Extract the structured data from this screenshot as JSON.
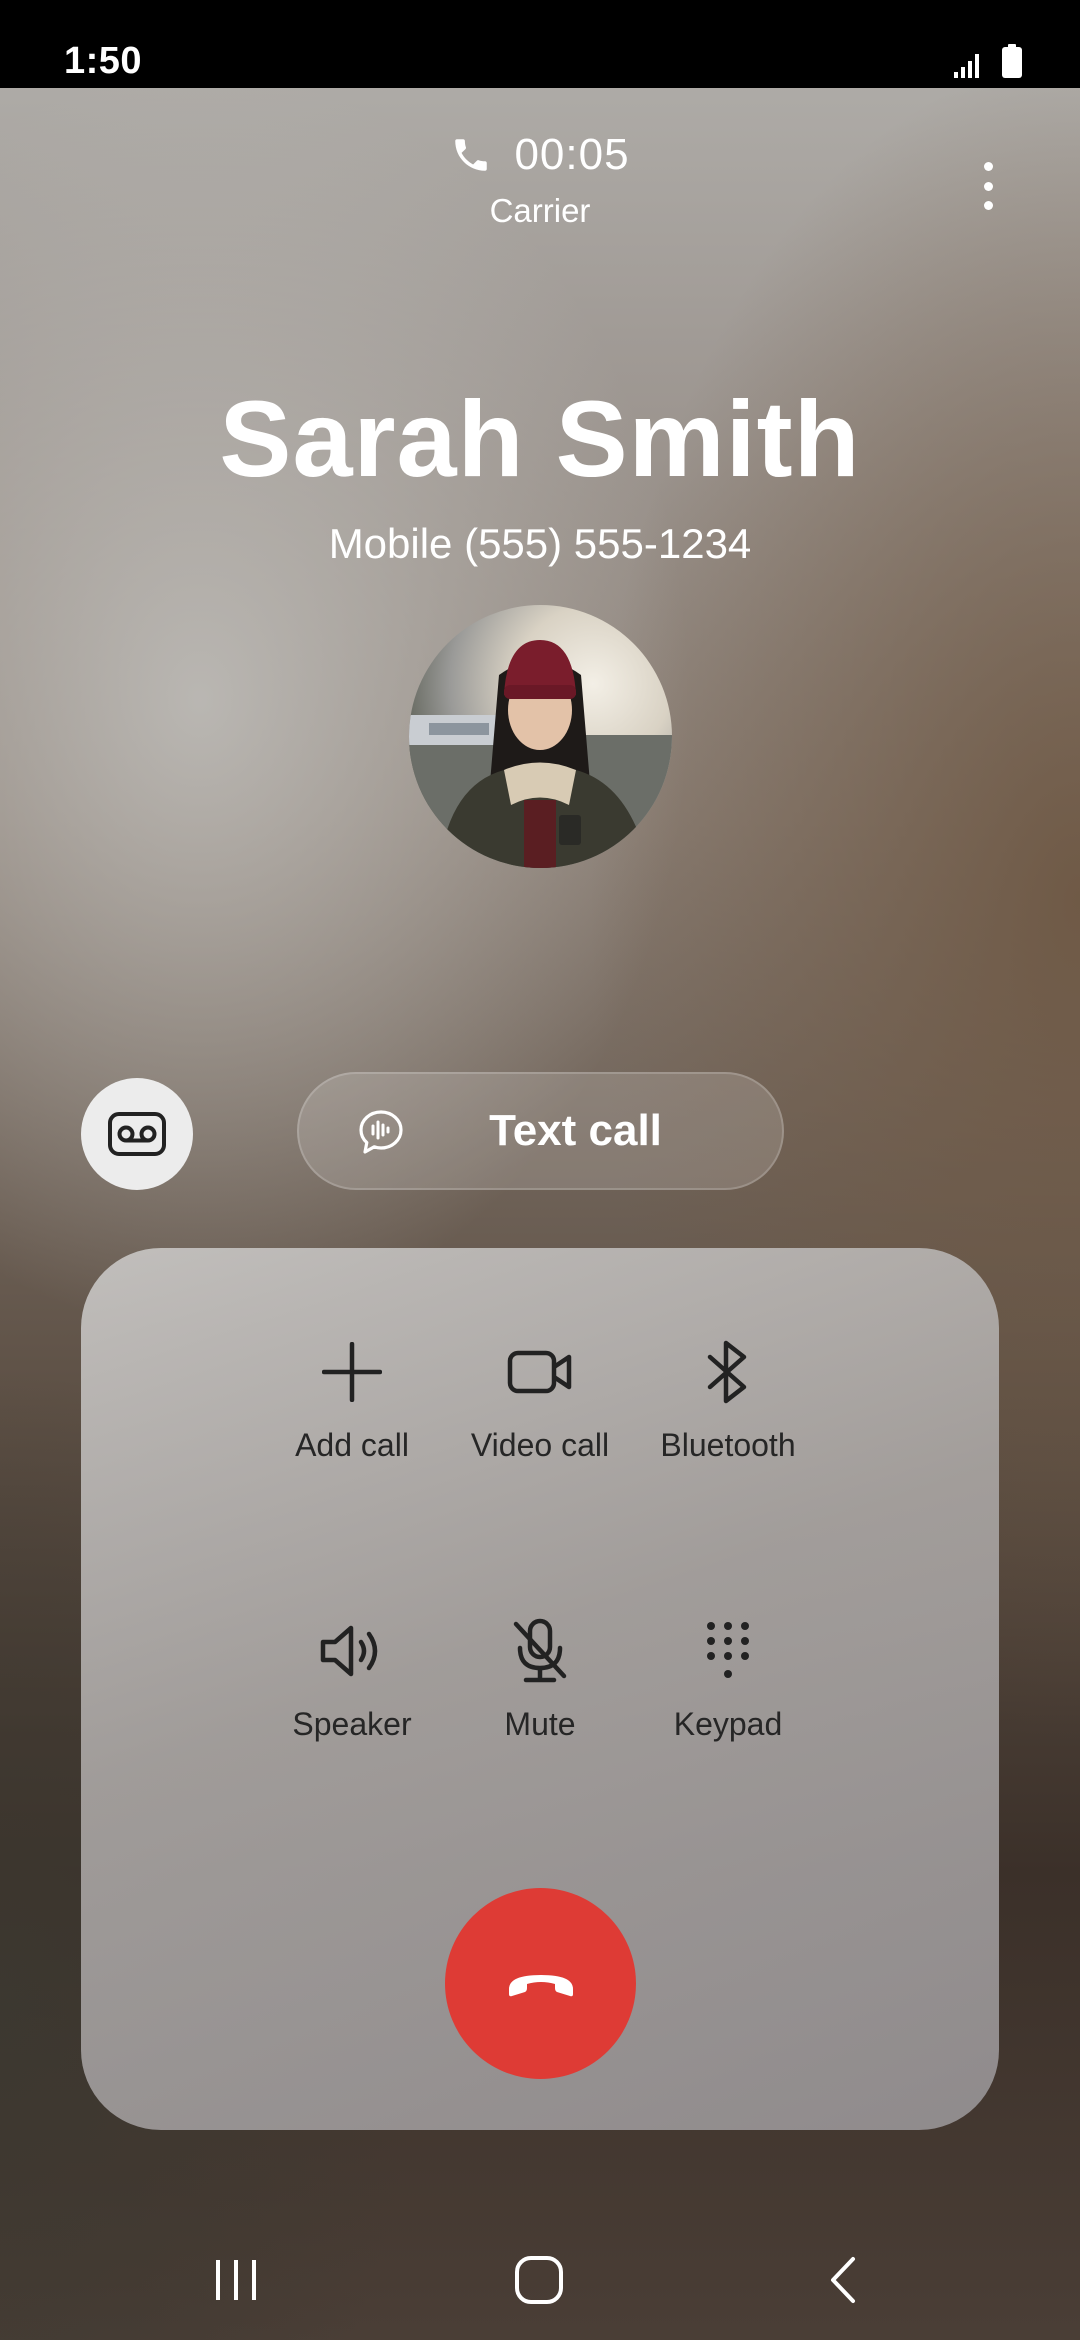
{
  "status_bar": {
    "time": "1:50"
  },
  "call": {
    "duration": "00:05",
    "carrier": "Carrier"
  },
  "contact": {
    "name": "Sarah Smith",
    "number": "Mobile (555) 555-1234"
  },
  "actions": {
    "text_call_label": "Text call"
  },
  "controls": {
    "add_call": "Add call",
    "video_call": "Video call",
    "bluetooth": "Bluetooth",
    "speaker": "Speaker",
    "mute": "Mute",
    "keypad": "Keypad"
  },
  "colors": {
    "end_call": "#de3b35",
    "panel": "#b0adab"
  },
  "icons": {
    "call_status": "phone-icon",
    "more": "more-vertical-icon",
    "voicemail": "voicemail-icon",
    "text_call": "chat-bubble-icon",
    "add_call": "plus-icon",
    "video_call": "video-camera-icon",
    "bluetooth": "bluetooth-icon",
    "speaker": "speaker-icon",
    "mute": "microphone-off-icon",
    "keypad": "keypad-icon",
    "end_call": "phone-hangup-icon",
    "nav_recents": "recents-icon",
    "nav_home": "home-icon",
    "nav_back": "back-icon"
  }
}
